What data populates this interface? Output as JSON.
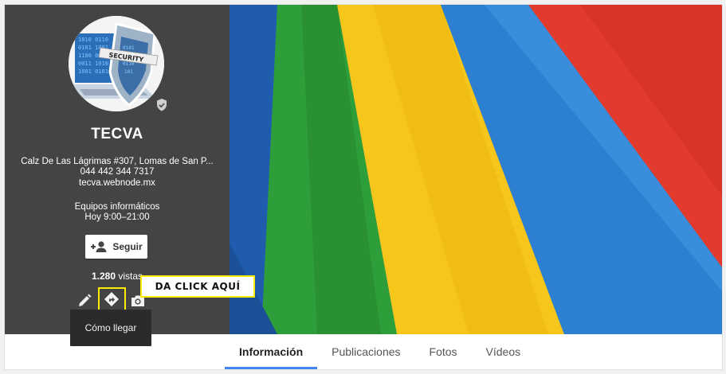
{
  "profile": {
    "name": "TECVA",
    "address": "Calz De Las Lágrimas #307, Lomas de San P...",
    "phone": "044 442 344 7317",
    "website": "tecva.webnode.mx",
    "category": "Equipos informáticos",
    "hours": "Hoy 9:00–21:00",
    "follow_label": "Seguir",
    "views_count": "1.280",
    "views_suffix": " vistas",
    "avatar_text": "SECURITY"
  },
  "actions": {
    "edit_icon": "pencil-icon",
    "directions_icon": "directions-icon",
    "photo_icon": "camera-icon",
    "tooltip": "Cómo llegar"
  },
  "annotation": {
    "callout": "DA CLICK AQUÍ",
    "highlight_color": "#ffee00"
  },
  "tabs": [
    {
      "label": "Información",
      "active": true
    },
    {
      "label": "Publicaciones",
      "active": false
    },
    {
      "label": "Fotos",
      "active": false
    },
    {
      "label": "Vídeos",
      "active": false
    }
  ],
  "colors": {
    "sidebar_bg": "#444444",
    "accent": "#4285f4",
    "cover_green": "#2e9e3a",
    "cover_yellow": "#f6c61b",
    "cover_blue": "#2c7fd1",
    "cover_red": "#e23b2e"
  }
}
